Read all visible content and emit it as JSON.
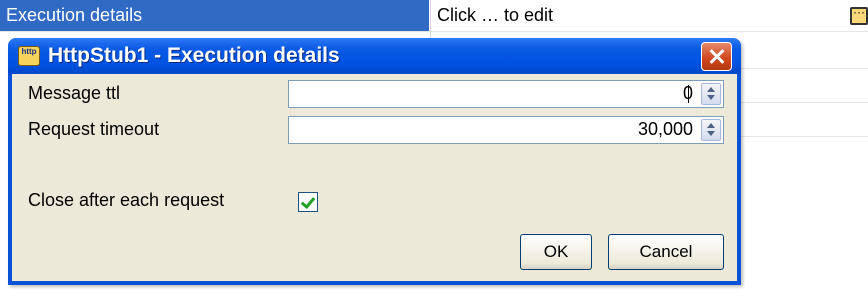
{
  "property_grid": {
    "selected_property": "Execution details",
    "selected_value": "Click … to edit"
  },
  "dialog": {
    "title": "HttpStub1 - Execution details",
    "icon_label": "http",
    "fields": {
      "message_ttl": {
        "label": "Message ttl",
        "value": "0"
      },
      "request_timeout": {
        "label": "Request timeout",
        "value": "30,000"
      },
      "close_after_each_request": {
        "label": "Close after each request",
        "checked": true
      }
    },
    "buttons": {
      "ok": "OK",
      "cancel": "Cancel"
    }
  },
  "colors": {
    "selection": "#316ac5",
    "titlebar": "#0054e3",
    "dialog_face": "#ece9d8",
    "close_button": "#d0451b"
  },
  "icons": {
    "dialog_icon": "http-stub-icon",
    "close": "close-icon",
    "edit": "ellipsis-edit-icon",
    "spin": "spin-arrows-icon",
    "check": "checkmark-icon"
  }
}
